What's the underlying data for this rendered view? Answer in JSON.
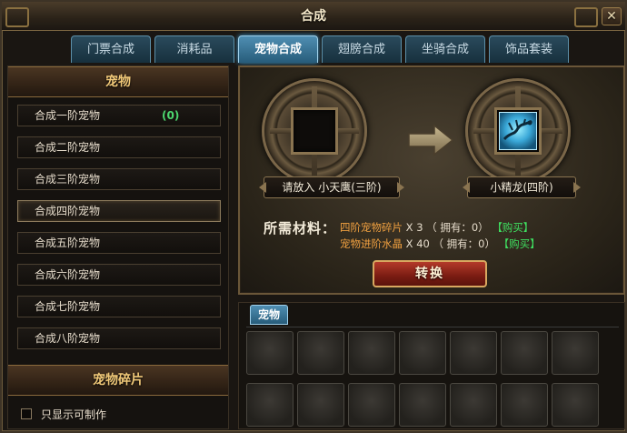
{
  "window": {
    "title": "合成",
    "close_glyph": "✕"
  },
  "tabs": [
    {
      "label": "门票合成",
      "active": false
    },
    {
      "label": "消耗品",
      "active": false
    },
    {
      "label": "宠物合成",
      "active": true
    },
    {
      "label": "翅膀合成",
      "active": false
    },
    {
      "label": "坐骑合成",
      "active": false
    },
    {
      "label": "饰品套装",
      "active": false
    }
  ],
  "sidebar": {
    "pet_header": "宠物",
    "items": [
      {
        "label": "合成一阶宠物",
        "count": "(0)"
      },
      {
        "label": "合成二阶宠物"
      },
      {
        "label": "合成三阶宠物"
      },
      {
        "label": "合成四阶宠物",
        "selected": true
      },
      {
        "label": "合成五阶宠物"
      },
      {
        "label": "合成六阶宠物"
      },
      {
        "label": "合成七阶宠物"
      },
      {
        "label": "合成八阶宠物"
      }
    ],
    "fragment_header": "宠物碎片",
    "filter_label": "只显示可制作"
  },
  "craft": {
    "input_slot_label": "请放入 小天鹰(三阶)",
    "output_slot_label": "小精龙(四阶)",
    "output_icon": "dragon-pet-icon",
    "arrow_icon": "arrow-right-icon",
    "materials_label": "所需材料：",
    "materials": [
      {
        "name": "四阶宠物碎片",
        "qty": "X 3",
        "owned": "（ 拥有：0）",
        "buy": "【购买】"
      },
      {
        "name": "宠物进阶水晶",
        "qty": "X 40",
        "owned": "（ 拥有：0）",
        "buy": "【购买】"
      }
    ],
    "convert_button": "转换"
  },
  "inventory": {
    "tab_label": "宠物",
    "slot_count": 14
  },
  "colors": {
    "accent_blue": "#4f8eb2",
    "header_gold": "#f0c878",
    "material_orange": "#f0a040",
    "buy_green": "#3fe060",
    "convert_red": "#b43a2a"
  }
}
